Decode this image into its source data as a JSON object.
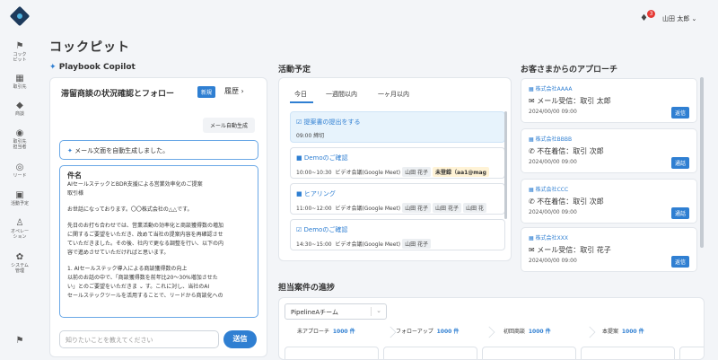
{
  "nav": {
    "items": [
      {
        "label": "コック\nピット",
        "icon": "flag-icon"
      },
      {
        "label": "取引先",
        "icon": "building-icon"
      },
      {
        "label": "商談",
        "icon": "diamond-icon"
      },
      {
        "label": "取引先\n担当者",
        "icon": "contact-icon"
      },
      {
        "label": "リード",
        "icon": "lead-icon"
      },
      {
        "label": "活動予定",
        "icon": "calendar-check-icon"
      },
      {
        "label": "オペレー\nション",
        "icon": "operation-icon"
      },
      {
        "label": "システム\n管理",
        "icon": "gear-icon"
      }
    ]
  },
  "header": {
    "notification_count": "3",
    "user_name": "山田 太郎"
  },
  "page": {
    "title": "コックピット"
  },
  "copilot": {
    "section_title": "Playbook Copilot",
    "title": "滞留商談の状況確認とフォロー",
    "new_label": "新規",
    "history_label": "履歴",
    "mail_gen_button": "メール自動生成",
    "system_message": "メール文面を自動生成しました。",
    "draft_subject_label": "件名",
    "draft_subject": "AIセールステックとBDR支援による営業効率化のご提案",
    "draft_to": "取引様",
    "draft_greeting": "お世話になっております。〇〇株式会社の△△です。",
    "draft_p1": [
      "先日のお打ち合わせでは、営業活動の効率化と商談獲得数の増加",
      "に関するご要望をいただき、改めて当社の提案内容を再確認させ",
      "ていただきました。その後、社内で更なる調整を行い、以下の内",
      "容で進めさせていただければと思います。"
    ],
    "draft_p2": [
      "1. AIセールステック導入による商談獲得数の向上",
      "以前のお話の中で、「商談獲得数を前年比20〜30%増加させた",
      "い」とのご要望をいただきま",
      "す。これに対し、当社のAI"
    ],
    "draft_p3": "セールステックツールを活用することで、リードから商談化への",
    "ask_placeholder": "知りたいことを教えてください",
    "send_label": "送信"
  },
  "schedule": {
    "section_title": "活動予定",
    "tabs": [
      "今日",
      "一週間以内",
      "一ヶ月以内"
    ],
    "items": [
      {
        "title": "提案書の提出をする",
        "time": "09:00 締切",
        "chips": []
      },
      {
        "title": "Demoのご確認",
        "time": "10:00~10:30",
        "where": "ビデオ会議(Google Meet)",
        "chips": [
          "山田 花子"
        ],
        "warn": "未登録（aa1@mag"
      },
      {
        "title": "ヒアリング",
        "time": "11:00~12:00",
        "where": "ビデオ会議(Google Meet)",
        "chips": [
          "山田 花子",
          "山田 花子",
          "山田 花"
        ]
      },
      {
        "title": "Demoのご確認",
        "time": "14:30~15:00",
        "where": "ビデオ会議(Google Meet)",
        "chips": [
          "山田 花子"
        ]
      }
    ]
  },
  "approach": {
    "section_title": "お客さまからのアプローチ",
    "items": [
      {
        "company": "株式会社AAAA",
        "event": "メール受信：取引 太郎",
        "time": "2024/00/00 09:00",
        "button": "返信",
        "icon": "mail-icon"
      },
      {
        "company": "株式会社BBBB",
        "event": "不在着信：取引 次郎",
        "time": "2024/00/00 09:00",
        "button": "通話",
        "icon": "phone-icon"
      },
      {
        "company": "株式会社CCC",
        "event": "不在着信：取引 次郎",
        "time": "2024/00/00 09:00",
        "button": "通話",
        "icon": "phone-icon"
      },
      {
        "company": "株式会社XXX",
        "event": "メール受信：取引 花子",
        "time": "2024/00/00 09:00",
        "button": "返信",
        "icon": "mail-icon"
      }
    ]
  },
  "progress": {
    "section_title": "担当案件の進捗",
    "pipeline": "PipelineAチーム",
    "stages": [
      {
        "label": "未アプローチ",
        "count": "1000 件"
      },
      {
        "label": "フォローアップ",
        "count": "1000 件"
      },
      {
        "label": "初回商談",
        "count": "1000 件"
      },
      {
        "label": "本提案",
        "count": "1000 件"
      }
    ]
  }
}
